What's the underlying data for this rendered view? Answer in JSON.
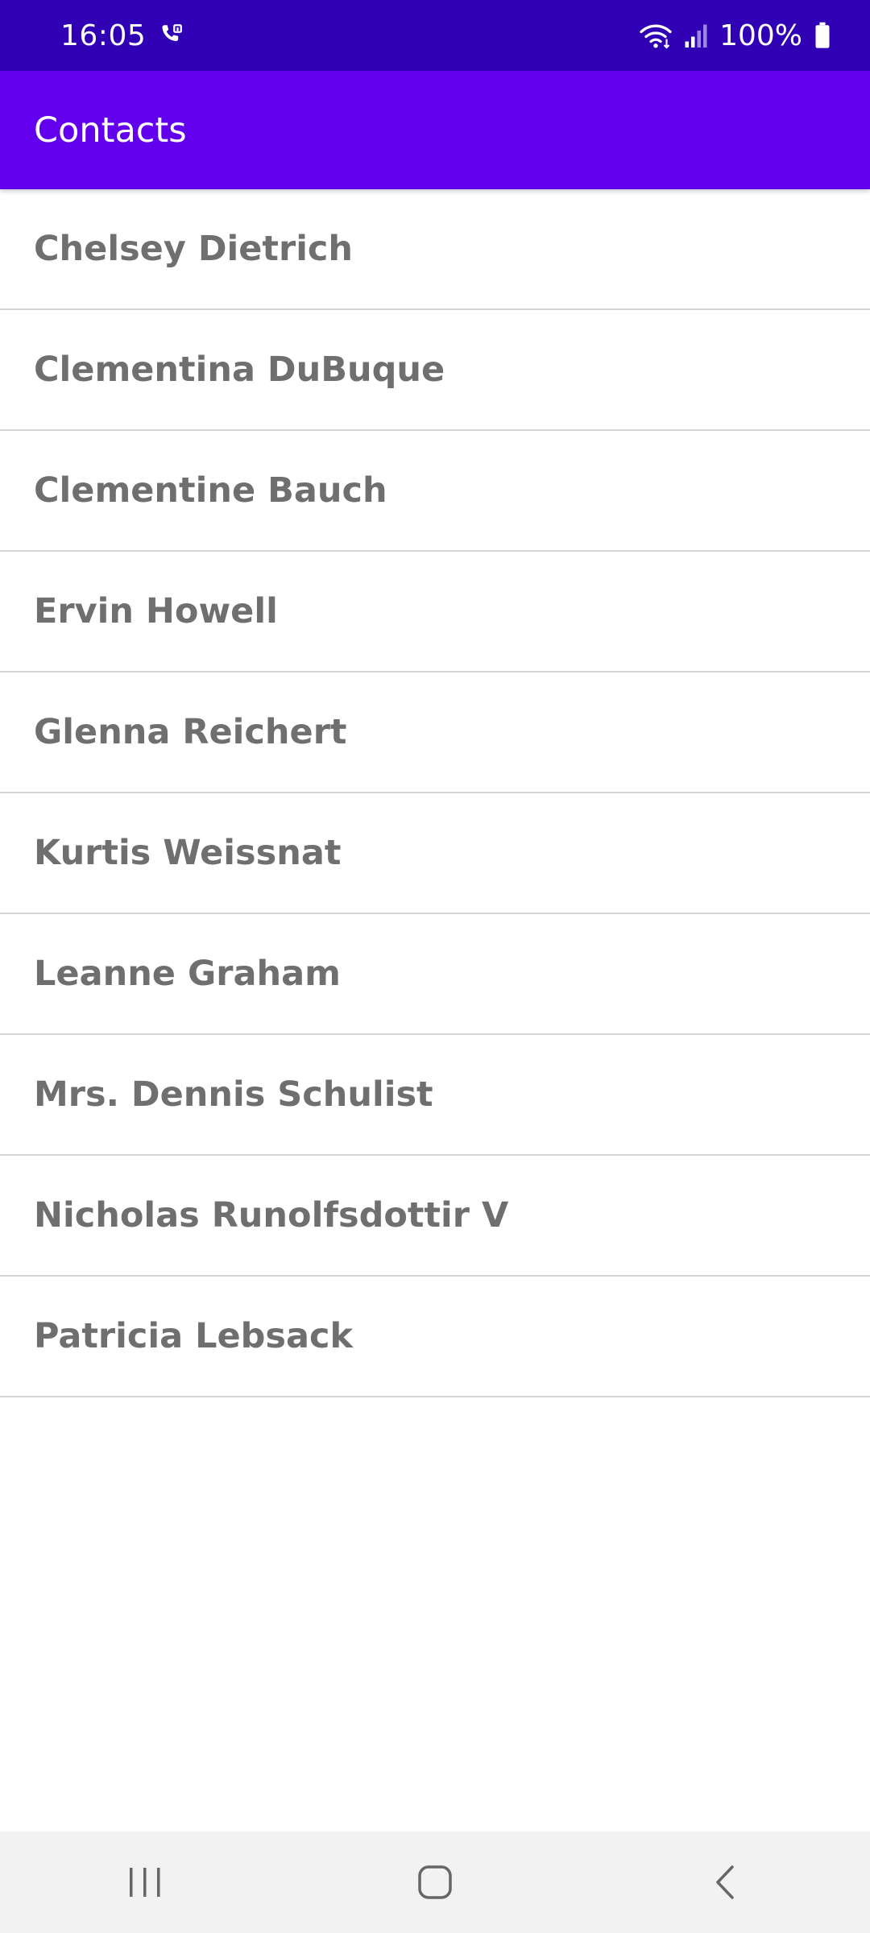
{
  "status_bar": {
    "time": "16:05",
    "battery_percent": "100%",
    "icons": [
      "call-icon",
      "wifi-icon",
      "signal-icon",
      "battery-icon"
    ],
    "background": "#3000b4"
  },
  "app_bar": {
    "title": "Contacts",
    "background": "#6200ee"
  },
  "contacts": [
    {
      "name": "Chelsey Dietrich"
    },
    {
      "name": "Clementina DuBuque"
    },
    {
      "name": "Clementine Bauch"
    },
    {
      "name": "Ervin Howell"
    },
    {
      "name": "Glenna Reichert"
    },
    {
      "name": "Kurtis Weissnat"
    },
    {
      "name": "Leanne Graham"
    },
    {
      "name": "Mrs. Dennis Schulist"
    },
    {
      "name": "Nicholas Runolfsdottir V"
    },
    {
      "name": "Patricia Lebsack"
    }
  ],
  "nav_bar": {
    "buttons": [
      "recent-apps-icon",
      "home-icon",
      "back-icon"
    ]
  }
}
